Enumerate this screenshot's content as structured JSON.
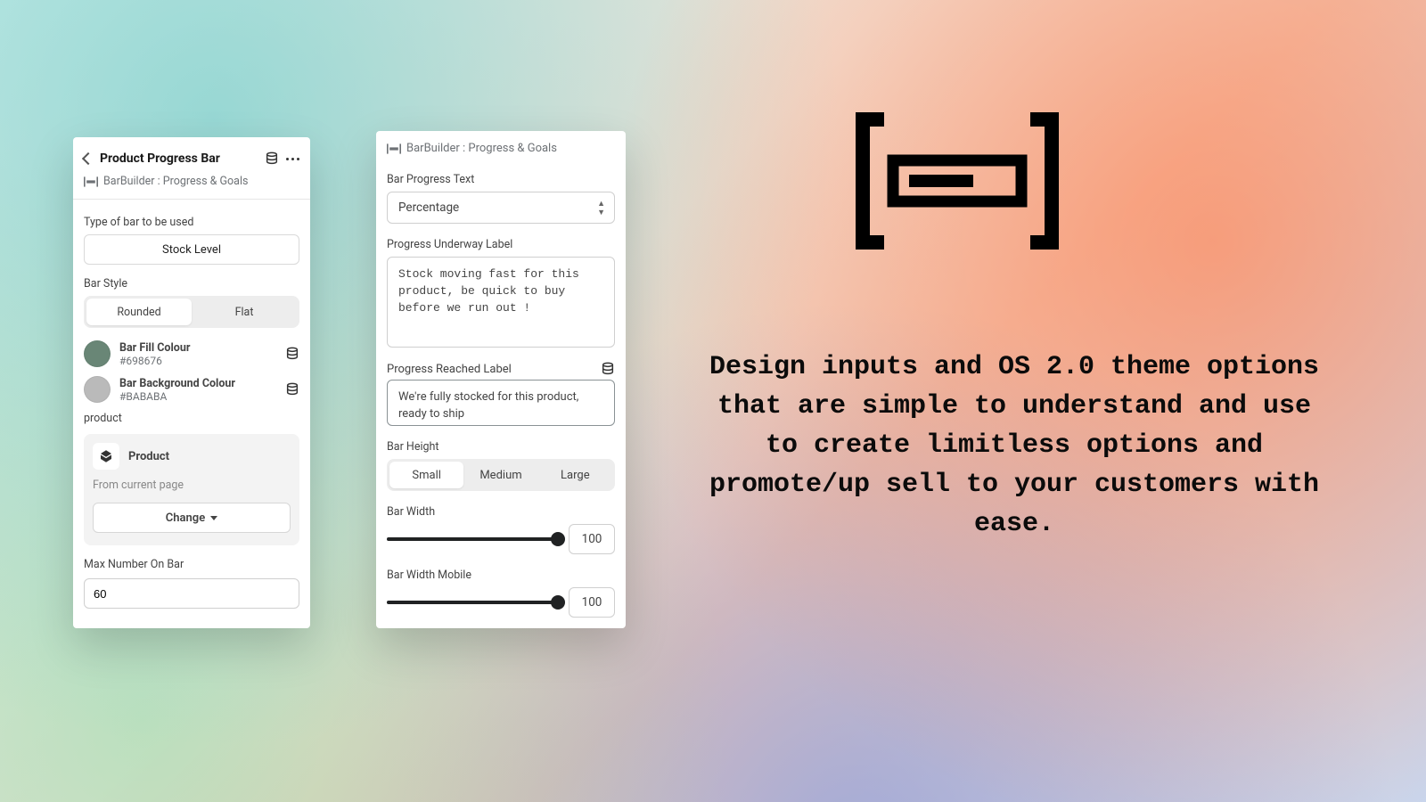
{
  "panelA": {
    "title": "Product Progress Bar",
    "subtitle": "BarBuilder : Progress & Goals",
    "type_label": "Type of bar to be used",
    "type_value": "Stock Level",
    "style_label": "Bar Style",
    "style_options": [
      "Rounded",
      "Flat"
    ],
    "style_active_index": 0,
    "fill": {
      "title": "Bar Fill Colour",
      "hex": "#698676"
    },
    "bg": {
      "title": "Bar Background Colour",
      "hex": "#BABABA"
    },
    "product_label": "product",
    "product_title": "Product",
    "product_from": "From current page",
    "change_label": "Change",
    "max_label": "Max Number On Bar",
    "max_value": "60"
  },
  "panelB": {
    "subtitle": "BarBuilder : Progress & Goals",
    "progress_text_label": "Bar Progress Text",
    "progress_text_value": "Percentage",
    "underway_label": "Progress Underway Label",
    "underway_value": "Stock moving fast for this product, be quick to buy before we run out !",
    "reached_label": "Progress Reached Label",
    "reached_value": "We're fully stocked for this product, ready to ship",
    "height_label": "Bar Height",
    "height_options": [
      "Small",
      "Medium",
      "Large"
    ],
    "height_active_index": 0,
    "width_label": "Bar Width",
    "width_value": "100",
    "width_mobile_label": "Bar Width Mobile",
    "width_mobile_value": "100"
  },
  "marketing_copy": "Design inputs and OS 2.0 theme options that are simple to understand and use to create limitless options and promote/up sell to your customers with ease."
}
